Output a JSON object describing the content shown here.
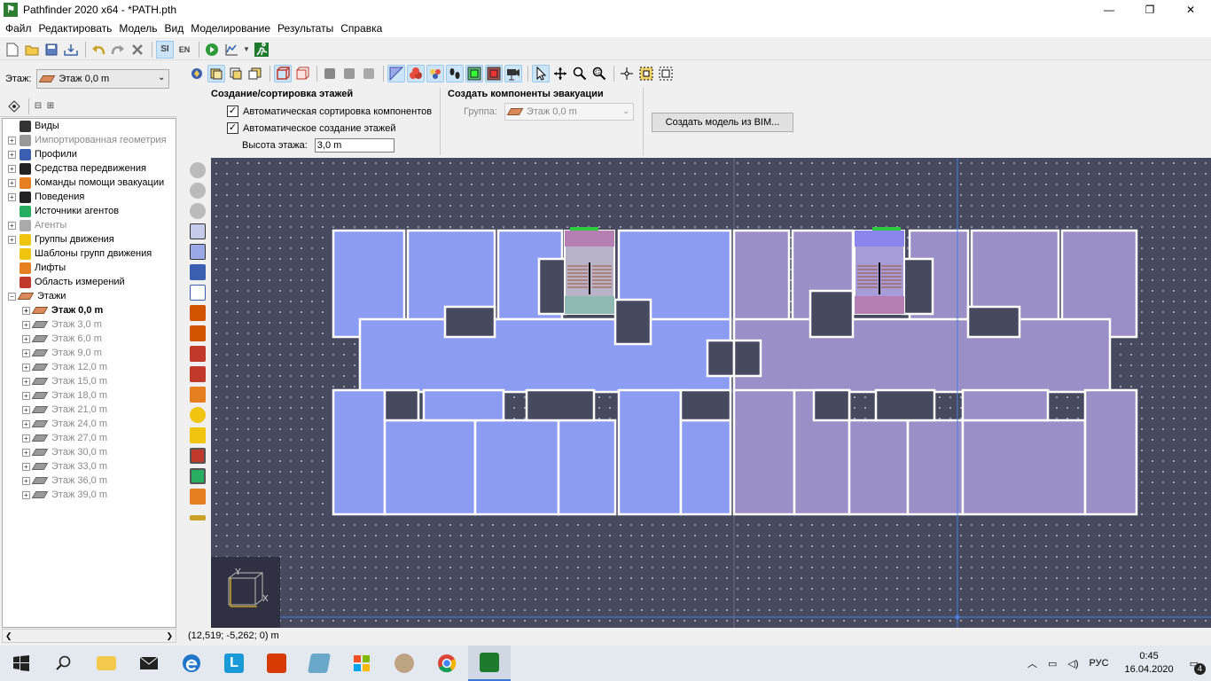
{
  "window": {
    "title": "Pathfinder 2020 x64 - *PATH.pth",
    "app_icon": "runner-icon",
    "minimize": "—",
    "maximize": "❐",
    "close": "✕"
  },
  "menu": [
    "Файл",
    "Редактировать",
    "Модель",
    "Вид",
    "Моделирование",
    "Результаты",
    "Справка"
  ],
  "toolbar": {
    "si_label": "SI",
    "en_label": "EN"
  },
  "floor_selector": {
    "label": "Этаж:",
    "value": "Этаж 0,0 m"
  },
  "tree": {
    "items": [
      {
        "label": "Виды",
        "icon": "camera-icon",
        "expandable": false,
        "dim": false,
        "indent": 0
      },
      {
        "label": "Импортированная геометрия",
        "icon": "geometry-icon",
        "expandable": true,
        "dim": true,
        "indent": 0
      },
      {
        "label": "Профили",
        "icon": "profile-icon",
        "expandable": true,
        "dim": false,
        "indent": 0
      },
      {
        "label": "Средства передвижения",
        "icon": "wheelchair-icon",
        "expandable": true,
        "dim": false,
        "indent": 0
      },
      {
        "label": "Команды помощи эвакуации",
        "icon": "assist-icon",
        "expandable": true,
        "dim": false,
        "indent": 0
      },
      {
        "label": "Поведения",
        "icon": "footsteps-icon",
        "expandable": true,
        "dim": false,
        "indent": 0
      },
      {
        "label": "Источники агентов",
        "icon": "source-icon",
        "expandable": false,
        "dim": false,
        "indent": 0
      },
      {
        "label": "Агенты",
        "icon": "agent-icon",
        "expandable": true,
        "dim": true,
        "indent": 0
      },
      {
        "label": "Группы движения",
        "icon": "group-icon",
        "expandable": true,
        "dim": false,
        "indent": 0
      },
      {
        "label": "Шаблоны групп движения",
        "icon": "template-icon",
        "expandable": false,
        "dim": false,
        "indent": 0
      },
      {
        "label": "Лифты",
        "icon": "elevator-icon",
        "expandable": false,
        "dim": false,
        "indent": 0
      },
      {
        "label": "Область измерений",
        "icon": "measure-icon",
        "expandable": false,
        "dim": false,
        "indent": 0
      },
      {
        "label": "Этажи",
        "icon": "floor-icon",
        "expandable": true,
        "expanded": true,
        "dim": false,
        "indent": 0
      },
      {
        "label": "Этаж 0,0 m",
        "icon": "floor-icon",
        "expandable": true,
        "dim": false,
        "bold": true,
        "indent": 1
      },
      {
        "label": "Этаж 3,0 m",
        "icon": "floor-gray-icon",
        "expandable": true,
        "dim": true,
        "indent": 1
      },
      {
        "label": "Этаж 6,0 m",
        "icon": "floor-gray-icon",
        "expandable": true,
        "dim": true,
        "indent": 1
      },
      {
        "label": "Этаж 9,0 m",
        "icon": "floor-gray-icon",
        "expandable": true,
        "dim": true,
        "indent": 1
      },
      {
        "label": "Этаж 12,0 m",
        "icon": "floor-gray-icon",
        "expandable": true,
        "dim": true,
        "indent": 1
      },
      {
        "label": "Этаж 15,0 m",
        "icon": "floor-gray-icon",
        "expandable": true,
        "dim": true,
        "indent": 1
      },
      {
        "label": "Этаж 18,0 m",
        "icon": "floor-gray-icon",
        "expandable": true,
        "dim": true,
        "indent": 1
      },
      {
        "label": "Этаж 21,0 m",
        "icon": "floor-gray-icon",
        "expandable": true,
        "dim": true,
        "indent": 1
      },
      {
        "label": "Этаж 24,0 m",
        "icon": "floor-gray-icon",
        "expandable": true,
        "dim": true,
        "indent": 1
      },
      {
        "label": "Этаж 27,0 m",
        "icon": "floor-gray-icon",
        "expandable": true,
        "dim": true,
        "indent": 1
      },
      {
        "label": "Этаж 30,0 m",
        "icon": "floor-gray-icon",
        "expandable": true,
        "dim": true,
        "indent": 1
      },
      {
        "label": "Этаж 33,0 m",
        "icon": "floor-gray-icon",
        "expandable": true,
        "dim": true,
        "indent": 1
      },
      {
        "label": "Этаж 36,0 m",
        "icon": "floor-gray-icon",
        "expandable": true,
        "dim": true,
        "indent": 1
      },
      {
        "label": "Этаж 39,0 m",
        "icon": "floor-gray-icon",
        "expandable": true,
        "dim": true,
        "indent": 1
      }
    ]
  },
  "panel": {
    "floors_header": "Создание/сортировка этажей",
    "auto_sort": {
      "label": "Автоматическая сортировка компонентов",
      "checked": true
    },
    "auto_create": {
      "label": "Автоматическое создание этажей",
      "checked": true
    },
    "floor_height_label": "Высота этажа:",
    "floor_height_value": "3,0 m",
    "evac_header": "Создать компоненты эвакуации",
    "group_label": "Группа:",
    "group_value": "Этаж 0,0 m",
    "bim_button": "Создать модель из BIM..."
  },
  "axis": {
    "y": "Y",
    "x": "X"
  },
  "status": {
    "coordinates": "(12,519; -5,262; 0) m"
  },
  "colors": {
    "room_blue": "#8c9cf2",
    "room_purple": "#9a8fc6",
    "canvas": "#474a5e",
    "exit_green": "#2ecc40"
  },
  "taskbar": {
    "apps": [
      "windows-start-icon",
      "search-icon",
      "file-explorer-icon",
      "mail-icon",
      "edge-icon",
      "lync-icon",
      "office-icon",
      "notes-icon",
      "store-icon",
      "paint-icon",
      "chrome-icon",
      "pathfinder-icon"
    ],
    "lang": "РУС",
    "time": "0:45",
    "date": "16.04.2020",
    "notifications": "4"
  }
}
